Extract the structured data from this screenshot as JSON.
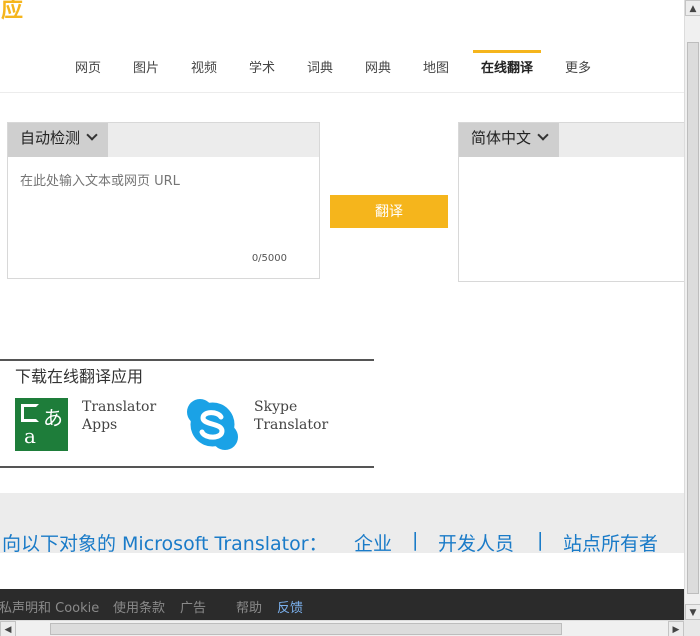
{
  "logo": "必应",
  "nav": {
    "items": [
      {
        "label": "网页"
      },
      {
        "label": "图片"
      },
      {
        "label": "视频"
      },
      {
        "label": "学术"
      },
      {
        "label": "词典"
      },
      {
        "label": "网典"
      },
      {
        "label": "地图"
      },
      {
        "label": "在线翻译",
        "active": true
      },
      {
        "label": "更多"
      }
    ]
  },
  "translator": {
    "source_lang": "自动检测",
    "source_placeholder": "在此处输入文本或网页 URL",
    "char_count": "0/5000",
    "translate_button": "翻译",
    "target_lang": "简体中文"
  },
  "apps": {
    "title": "下载在线翻译应用",
    "translator_app": [
      "Translator",
      "Apps"
    ],
    "skype_app": [
      "Skype",
      "Translator"
    ]
  },
  "ms_links": {
    "intro": "向以下对象的 Microsoft Translator：",
    "enterprise": "企业",
    "sep": "|",
    "developers": "开发人员",
    "site_owners": "站点所有者"
  },
  "footer": {
    "privacy": "隐私声明和 Cookie",
    "terms": "使用条款",
    "ads": "广告",
    "help": "帮助",
    "feedback": "反馈"
  },
  "colors": {
    "accent": "#f5b51c",
    "link": "#1a7bc8",
    "translator_app_green": "#1e7d3a",
    "skype_blue": "#1aa2e6"
  }
}
